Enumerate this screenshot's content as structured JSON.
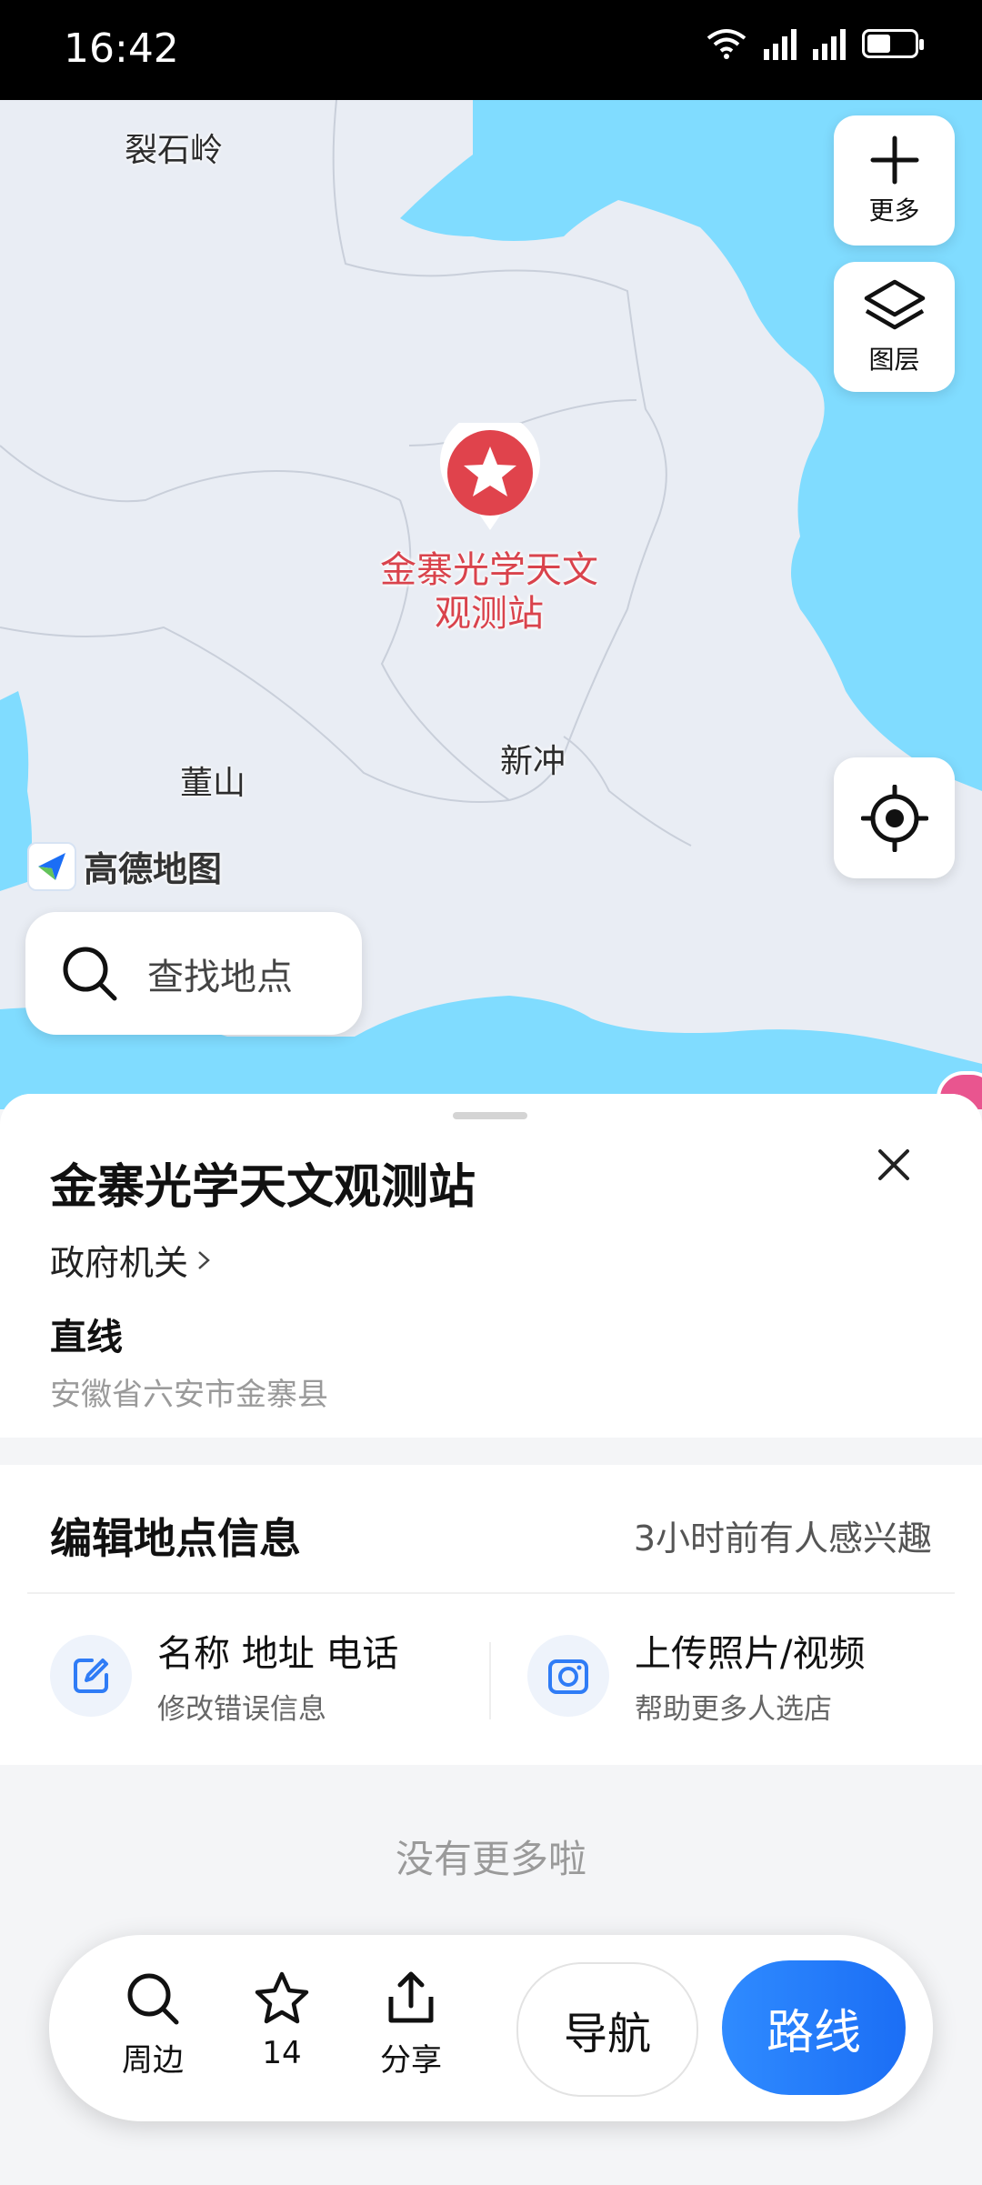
{
  "status": {
    "time": "16:42",
    "battery_level": 0.5
  },
  "map": {
    "places": {
      "lieshiling": "裂石岭",
      "dongshan": "董山",
      "xinchong": "新冲"
    },
    "poi_label": "金寨光学天文观测站",
    "buttons": {
      "more": "更多",
      "layers": "图层"
    },
    "logo_text": "高德地图",
    "search_placeholder": "查找地点"
  },
  "place_card": {
    "title": "金寨光学天文观测站",
    "category": "政府机关",
    "distance_label": "直线",
    "address": "安徽省六安市金寨县"
  },
  "edit_section": {
    "heading": "编辑地点信息",
    "interest": "3小时前有人感兴趣",
    "items": [
      {
        "title": "名称 地址 电话",
        "subtitle": "修改错误信息",
        "icon": "edit-icon"
      },
      {
        "title": "上传照片/视频",
        "subtitle": "帮助更多人选店",
        "icon": "camera-icon"
      }
    ]
  },
  "no_more": "没有更多啦",
  "bottom_bar": {
    "nearby": "周边",
    "favorite_count": "14",
    "share": "分享",
    "navigate": "导航",
    "route": "路线"
  },
  "colors": {
    "water": "#80dcff",
    "land": "#e9edf4",
    "poi": "#e0434c",
    "accent": "#1b6ef5"
  }
}
